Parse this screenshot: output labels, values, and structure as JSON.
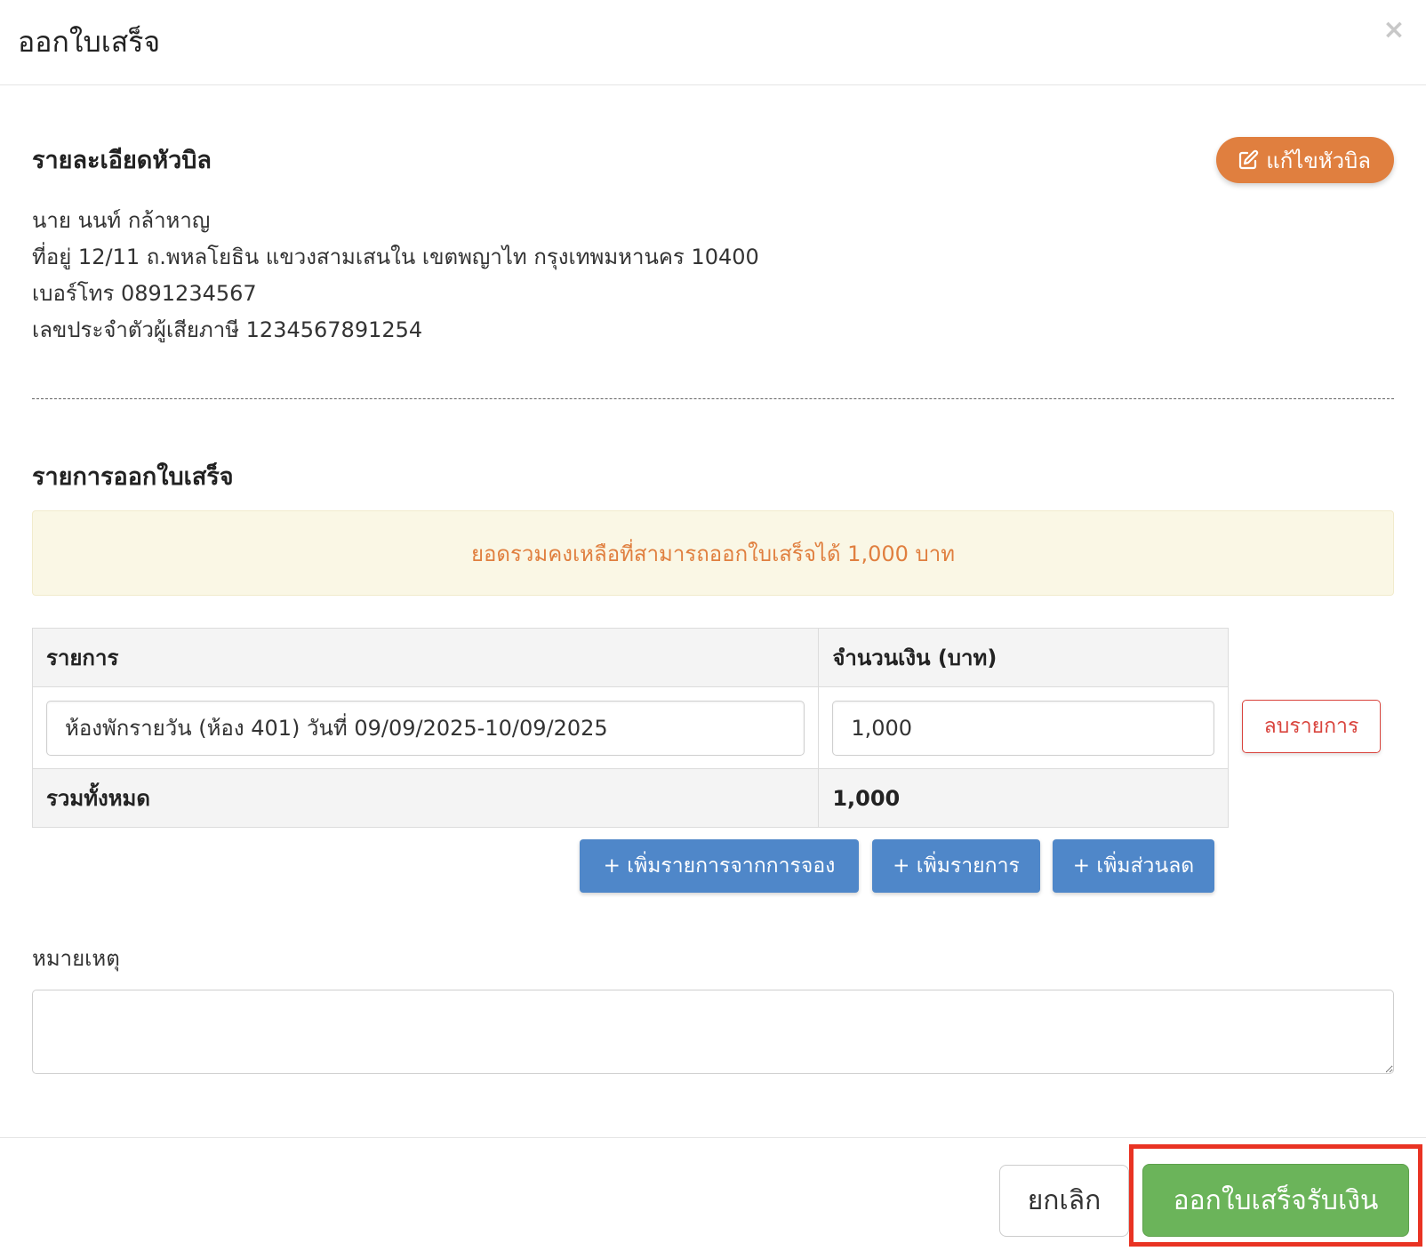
{
  "modal": {
    "title": "ออกใบเสร็จ",
    "close_icon": "×"
  },
  "header_section": {
    "title": "รายละเอียดหัวบิล",
    "edit_button_label": "แก้ไขหัวบิล",
    "edit_icon": "edit-icon",
    "customer": {
      "name": "นาย นนท์ กล้าหาญ",
      "address": "ที่อยู่ 12/11 ถ.พหลโยธิน แขวงสามเสนใน เขตพญาไท กรุงเทพมหานคร 10400",
      "phone": "เบอร์โทร 0891234567",
      "tax_id": "เลขประจำตัวผู้เสียภาษี 1234567891254"
    }
  },
  "items_section": {
    "title": "รายการออกใบเสร็จ",
    "notice": "ยอดรวมคงเหลือที่สามารถออกใบเสร็จได้ 1,000 บาท",
    "columns": [
      "รายการ",
      "จำนวนเงิน (บาท)"
    ],
    "rows": [
      {
        "description": "ห้องพักรายวัน (ห้อง 401) วันที่ 09/09/2025-10/09/2025",
        "amount": "1,000",
        "remove_label": "ลบรายการ"
      }
    ],
    "total_label": "รวมทั้งหมด",
    "total_value": "1,000",
    "add_from_booking_label": "+ เพิ่มรายการจากการจอง",
    "add_item_label": "+ เพิ่มรายการ",
    "add_discount_label": "+ เพิ่มส่วนลด"
  },
  "remark": {
    "label": "หมายเหตุ",
    "value": ""
  },
  "footer": {
    "cancel_label": "ยกเลิก",
    "submit_label": "ออกใบเสร็จรับเงิน"
  },
  "colors": {
    "edit_button": "#e07f3f",
    "notice_text": "#e07f3f",
    "notice_bg": "#faf7e5",
    "blue_button": "#4f87c9",
    "remove_button": "#d9443d",
    "submit_button": "#6bb45a",
    "highlight": "#e93323"
  }
}
